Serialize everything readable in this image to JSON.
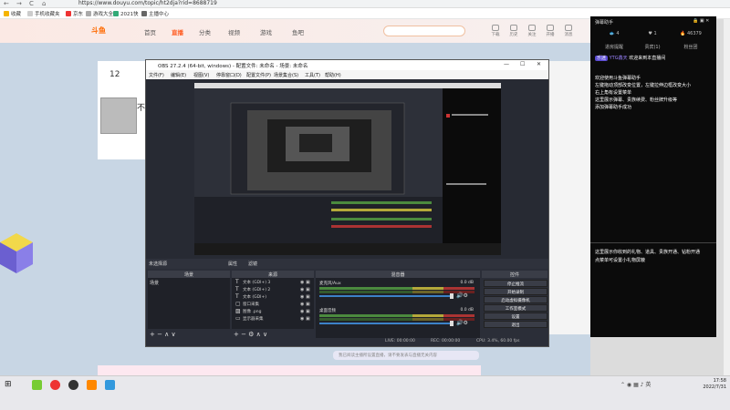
{
  "browser": {
    "url": "https://www.douyu.com/topic/ht2dja?rid=8688719",
    "back": "←",
    "forward": "→",
    "reload": "C",
    "home": "⌂",
    "bookmarks": [
      "收藏",
      "手机收藏夹",
      "京东",
      "游戏大全",
      "2021快",
      "主播中心"
    ]
  },
  "douyu": {
    "logo": "斗鱼",
    "nav": [
      "首页",
      "直播",
      "分类",
      "视频",
      "游戏",
      "鱼吧"
    ],
    "active_nav": "直播",
    "header_icons": [
      "下载",
      "历史",
      "关注",
      "开播",
      "消息"
    ],
    "room_number": "12",
    "room_avatar_text": "不",
    "bottom_input_placeholder": "我已阅读主播所设置直播，请不要发表与直播无关内容"
  },
  "obs": {
    "title": "OBS 27.2.4 (64-bit, windows) - 配置文件: 未命名 - 场景: 未命名",
    "menu": [
      "文件(F)",
      "编辑(E)",
      "视图(V)",
      "停靠窗口(D)",
      "配置文件(P)",
      "场景集合(S)",
      "工具(T)",
      "帮助(H)"
    ],
    "scene_bar_label": "未选择源",
    "scene_bar_props": "属性",
    "scene_bar_filters": "滤镜",
    "panes": {
      "scenes": "场景",
      "sources": "来源",
      "mixer": "混音器",
      "controls": "控件"
    },
    "scene_item": "场景",
    "sources": [
      {
        "icon": "T",
        "label": "文本 (GDI+) 3"
      },
      {
        "icon": "T",
        "label": "文本 (GDI+) 2"
      },
      {
        "icon": "T",
        "label": "文本 (GDI+)"
      },
      {
        "icon": "▢",
        "label": "窗口采集"
      },
      {
        "icon": "▨",
        "label": "图像 .png"
      },
      {
        "icon": "▭",
        "label": "显示器采集"
      }
    ],
    "mixer": [
      {
        "label": "麦克风/Aux",
        "db": "0.0 dB"
      },
      {
        "label": "桌面音频",
        "db": "0.0 dB"
      }
    ],
    "controls": [
      "停止推流",
      "开始录制",
      "启动虚拟摄像机",
      "工作室模式",
      "设置",
      "退出"
    ],
    "status": {
      "live": "LIVE: 00:00:00",
      "rec": "REC: 00:00:00",
      "cpu": "CPU: 3.4%, 60.00 fps"
    }
  },
  "chat": {
    "title": "弹幕助手",
    "stats": [
      {
        "icon": "fish-icon",
        "value": "4"
      },
      {
        "icon": "heart-icon",
        "value": "1"
      },
      {
        "icon": "hot-icon",
        "value": "46379"
      }
    ],
    "tabs": [
      "进房提醒",
      "贵宾(1)",
      "粉丝团"
    ],
    "first_msg": {
      "badge": "乐迷",
      "user": "YTG鑫天",
      "text": "欢迎来到本直播间"
    },
    "lines1": [
      "欢迎使用斗鱼弹幕助手",
      "左键拖动顶部改变位置，左键拉伸边框改变大小",
      "右上角有设置菜单",
      "这里展示弹幕、贵族续费、粉丝牌升级等",
      "添加弹幕助手成功"
    ],
    "lines2": [
      "这里展示你收到的礼物、道具、贵族开通、钻粉开通",
      "点菜单可设置小礼物屏蔽"
    ]
  },
  "taskbar": {
    "time": "17:58",
    "date": "2022/7/31",
    "apps": [
      "start",
      "search",
      "app-green",
      "app-red",
      "app-obs",
      "app-orange",
      "app-blue"
    ]
  },
  "colors": {
    "douyu_orange": "#ff5d23",
    "obs_bg": "#272a33",
    "chat_badge": "#5a4ad1"
  }
}
